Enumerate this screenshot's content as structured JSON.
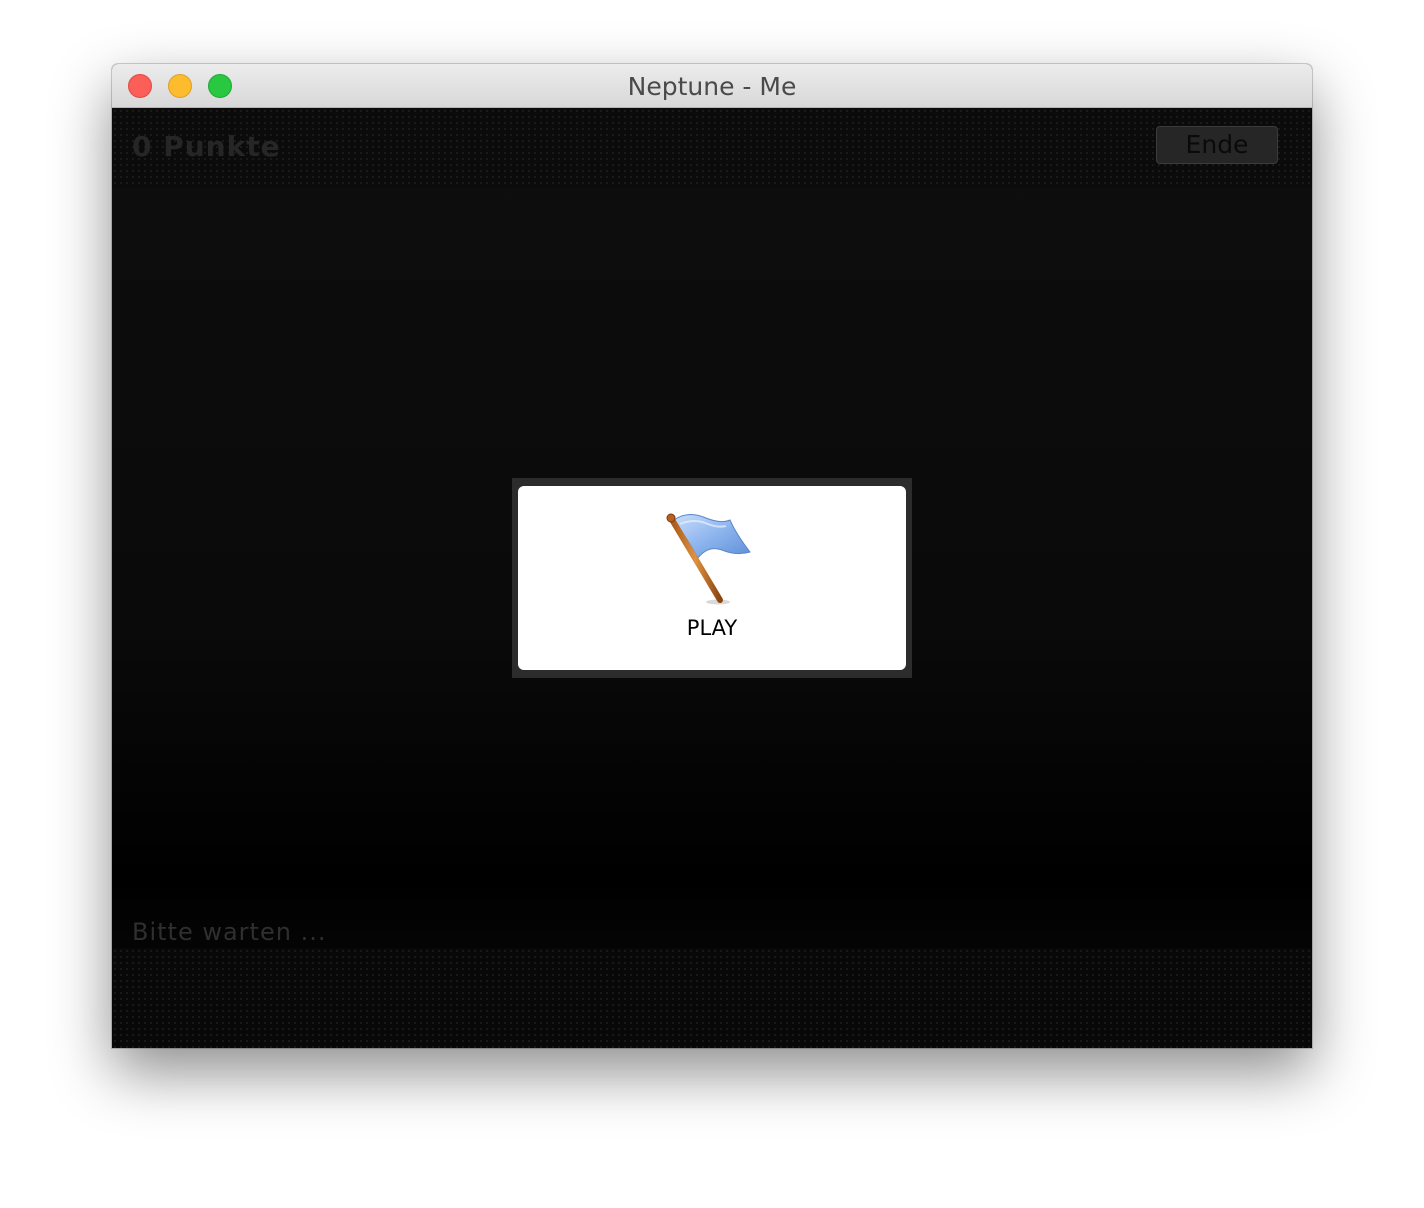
{
  "window": {
    "title": "Neptune - Me"
  },
  "header": {
    "score_label": "0 Punkte",
    "end_button_label": "Ende"
  },
  "dialog": {
    "play_label": "PLAY",
    "icon": "flag-icon"
  },
  "footer": {
    "status_text": "Bitte warten ..."
  },
  "colors": {
    "close": "#fc5f57",
    "minimize": "#fdbc2e",
    "maximize": "#29c841",
    "flag": "#8fb7ee"
  }
}
